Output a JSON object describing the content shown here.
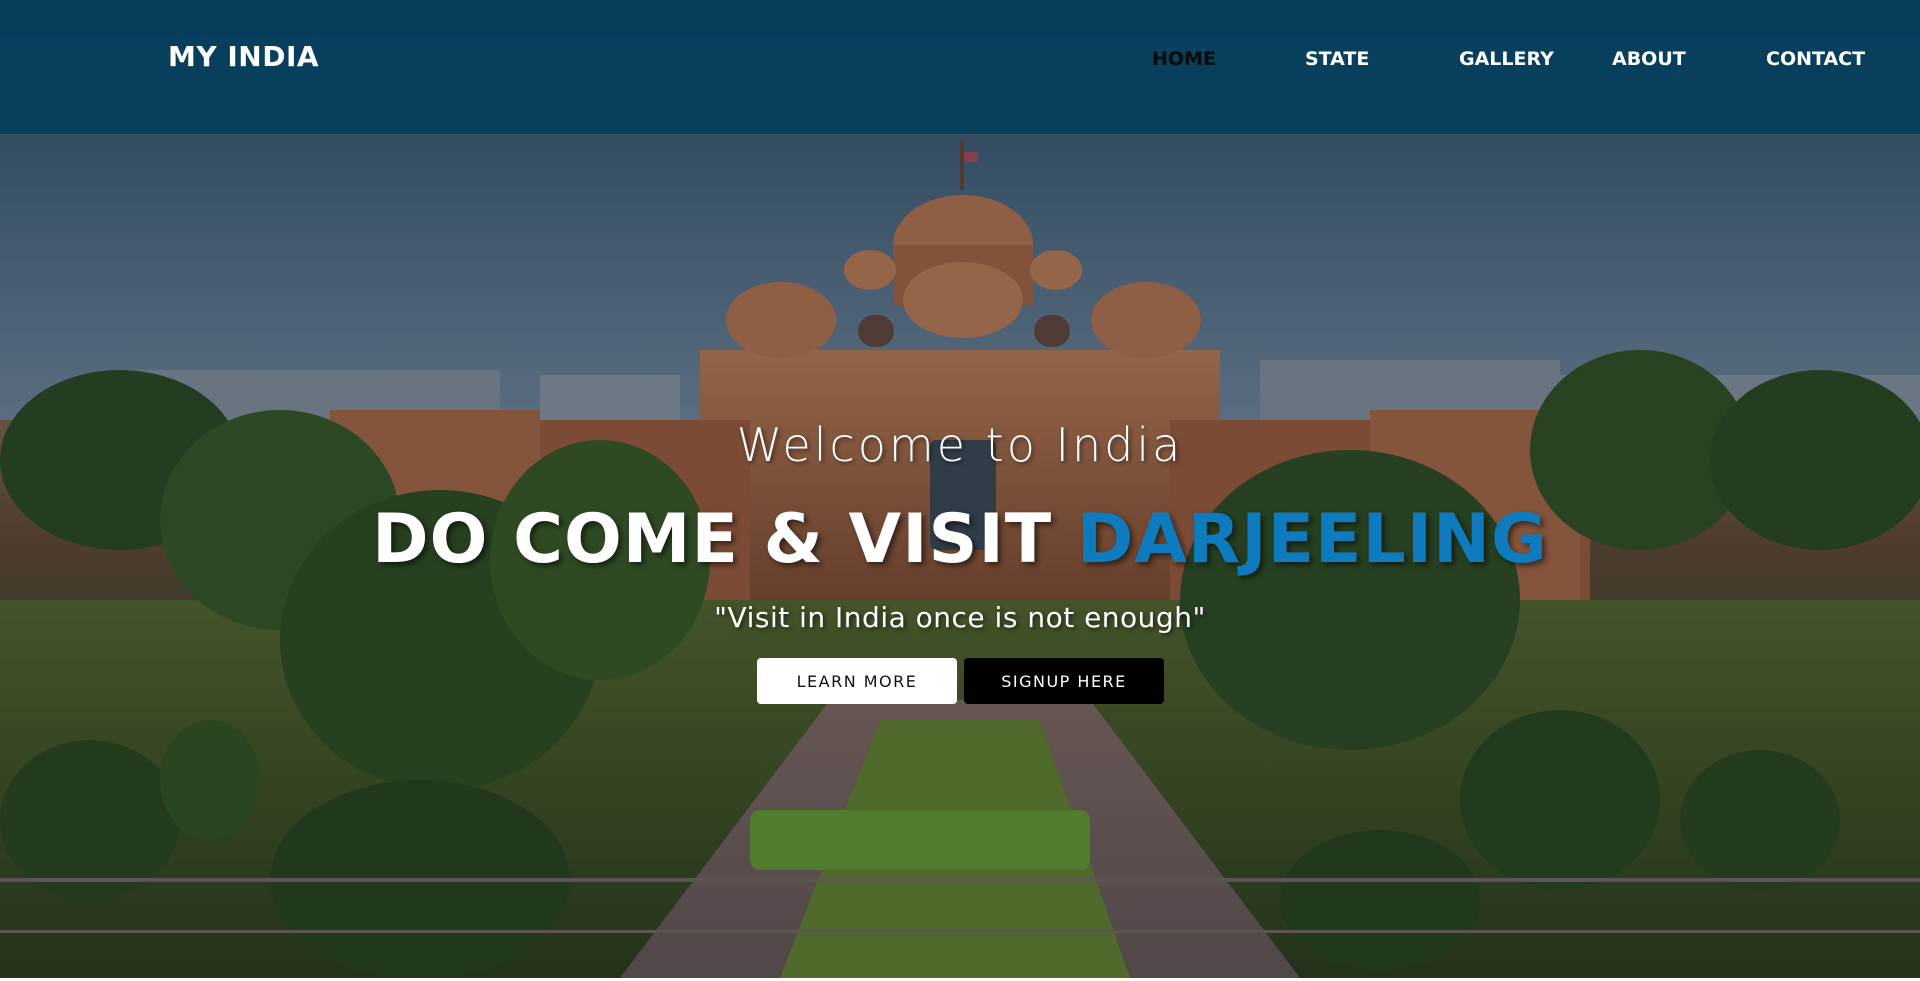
{
  "nav": {
    "brand": "MY INDIA",
    "items": [
      {
        "label": "HOME",
        "active": true
      },
      {
        "label": "STATE",
        "active": false
      },
      {
        "label": "GALLERY",
        "active": false
      },
      {
        "label": "ABOUT",
        "active": false
      },
      {
        "label": "CONTACT",
        "active": false
      }
    ]
  },
  "hero": {
    "welcome": "Welcome to India",
    "headline_prefix": "DO COME & VISIT",
    "headline_highlight": "DARJEELING",
    "quote": "\"Visit in India once is not enough\"",
    "learn_more_label": "LEARN MORE",
    "signup_label": "SIGNUP HERE"
  },
  "colors": {
    "navbar": "#003e5e",
    "accent": "#0f7bbf",
    "active_nav": "#0b0b0b",
    "signup_button": "#000000",
    "learn_button": "#ffffff"
  }
}
